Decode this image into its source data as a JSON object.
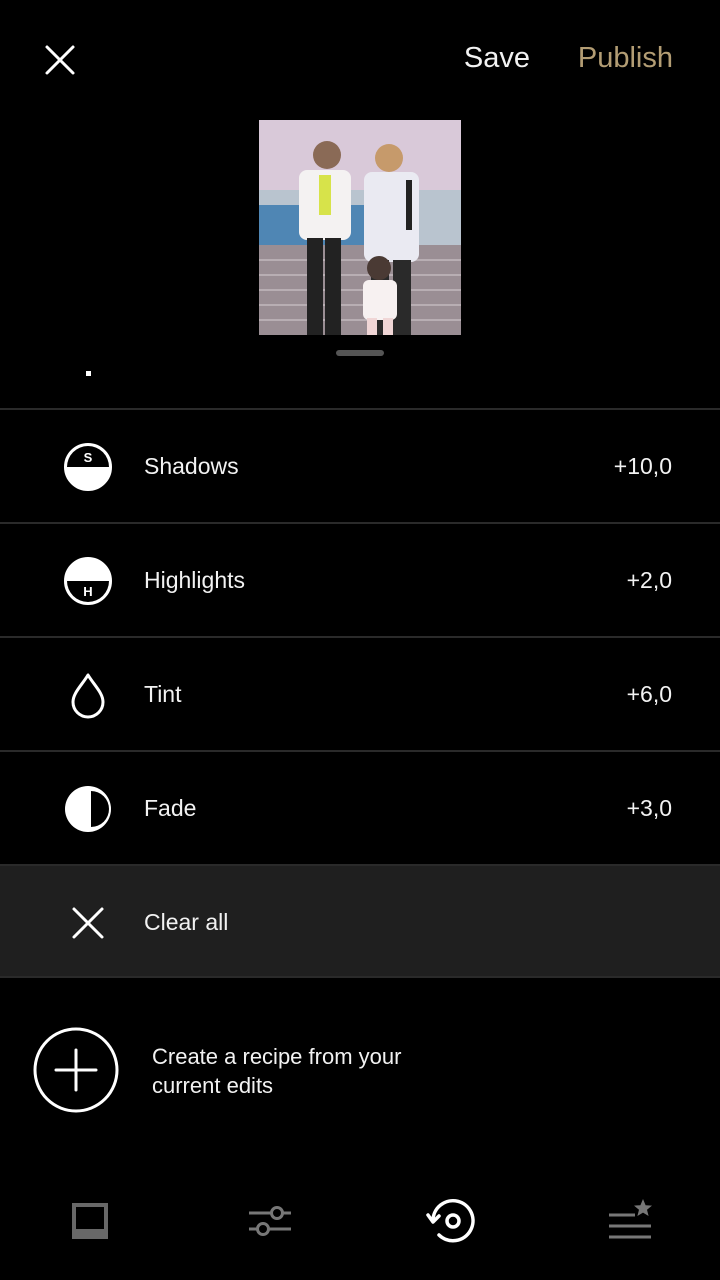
{
  "topbar": {
    "save_label": "Save",
    "publish_label": "Publish",
    "publish_color": "#b39d74"
  },
  "adjustments": [
    {
      "icon": "shadows-icon",
      "badge": "S",
      "label": "Shadows",
      "value": "+10,0"
    },
    {
      "icon": "highlights-icon",
      "badge": "H",
      "label": "Highlights",
      "value": "+2,0"
    },
    {
      "icon": "tint-drop-icon",
      "label": "Tint",
      "value": "+6,0"
    },
    {
      "icon": "fade-icon",
      "label": "Fade",
      "value": "+3,0"
    }
  ],
  "clear_all": {
    "icon": "close-icon",
    "label": "Clear all"
  },
  "recipe": {
    "icon": "plus-circle-icon",
    "text": "Create a recipe from your current edits"
  },
  "bottom_tabs": [
    {
      "name": "presets-tab",
      "icon": "presets-square-icon"
    },
    {
      "name": "tools-tab",
      "icon": "sliders-icon"
    },
    {
      "name": "history-tab",
      "icon": "history-icon",
      "active": true
    },
    {
      "name": "recipes-tab",
      "icon": "recipes-star-icon"
    }
  ]
}
